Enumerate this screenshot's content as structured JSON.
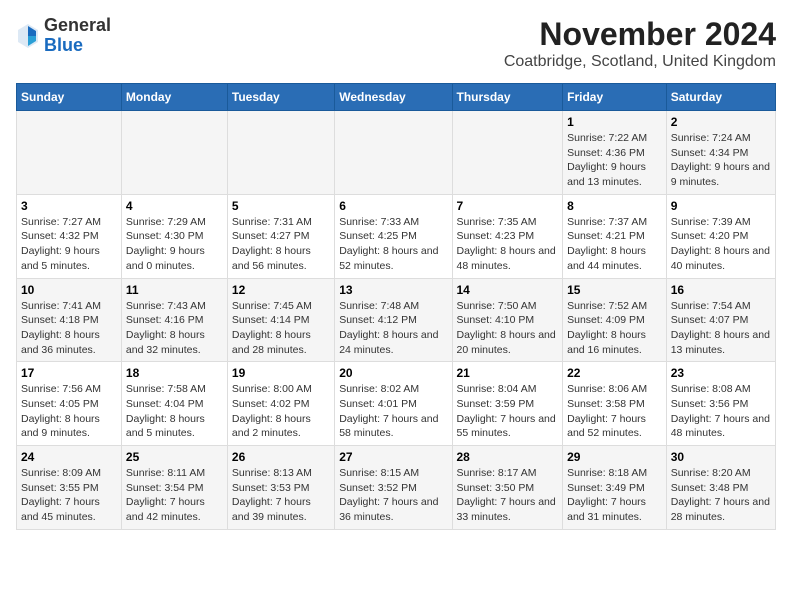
{
  "logo": {
    "general": "General",
    "blue": "Blue"
  },
  "title": "November 2024",
  "subtitle": "Coatbridge, Scotland, United Kingdom",
  "days_of_week": [
    "Sunday",
    "Monday",
    "Tuesday",
    "Wednesday",
    "Thursday",
    "Friday",
    "Saturday"
  ],
  "weeks": [
    [
      {
        "day": "",
        "info": ""
      },
      {
        "day": "",
        "info": ""
      },
      {
        "day": "",
        "info": ""
      },
      {
        "day": "",
        "info": ""
      },
      {
        "day": "",
        "info": ""
      },
      {
        "day": "1",
        "info": "Sunrise: 7:22 AM\nSunset: 4:36 PM\nDaylight: 9 hours and 13 minutes."
      },
      {
        "day": "2",
        "info": "Sunrise: 7:24 AM\nSunset: 4:34 PM\nDaylight: 9 hours and 9 minutes."
      }
    ],
    [
      {
        "day": "3",
        "info": "Sunrise: 7:27 AM\nSunset: 4:32 PM\nDaylight: 9 hours and 5 minutes."
      },
      {
        "day": "4",
        "info": "Sunrise: 7:29 AM\nSunset: 4:30 PM\nDaylight: 9 hours and 0 minutes."
      },
      {
        "day": "5",
        "info": "Sunrise: 7:31 AM\nSunset: 4:27 PM\nDaylight: 8 hours and 56 minutes."
      },
      {
        "day": "6",
        "info": "Sunrise: 7:33 AM\nSunset: 4:25 PM\nDaylight: 8 hours and 52 minutes."
      },
      {
        "day": "7",
        "info": "Sunrise: 7:35 AM\nSunset: 4:23 PM\nDaylight: 8 hours and 48 minutes."
      },
      {
        "day": "8",
        "info": "Sunrise: 7:37 AM\nSunset: 4:21 PM\nDaylight: 8 hours and 44 minutes."
      },
      {
        "day": "9",
        "info": "Sunrise: 7:39 AM\nSunset: 4:20 PM\nDaylight: 8 hours and 40 minutes."
      }
    ],
    [
      {
        "day": "10",
        "info": "Sunrise: 7:41 AM\nSunset: 4:18 PM\nDaylight: 8 hours and 36 minutes."
      },
      {
        "day": "11",
        "info": "Sunrise: 7:43 AM\nSunset: 4:16 PM\nDaylight: 8 hours and 32 minutes."
      },
      {
        "day": "12",
        "info": "Sunrise: 7:45 AM\nSunset: 4:14 PM\nDaylight: 8 hours and 28 minutes."
      },
      {
        "day": "13",
        "info": "Sunrise: 7:48 AM\nSunset: 4:12 PM\nDaylight: 8 hours and 24 minutes."
      },
      {
        "day": "14",
        "info": "Sunrise: 7:50 AM\nSunset: 4:10 PM\nDaylight: 8 hours and 20 minutes."
      },
      {
        "day": "15",
        "info": "Sunrise: 7:52 AM\nSunset: 4:09 PM\nDaylight: 8 hours and 16 minutes."
      },
      {
        "day": "16",
        "info": "Sunrise: 7:54 AM\nSunset: 4:07 PM\nDaylight: 8 hours and 13 minutes."
      }
    ],
    [
      {
        "day": "17",
        "info": "Sunrise: 7:56 AM\nSunset: 4:05 PM\nDaylight: 8 hours and 9 minutes."
      },
      {
        "day": "18",
        "info": "Sunrise: 7:58 AM\nSunset: 4:04 PM\nDaylight: 8 hours and 5 minutes."
      },
      {
        "day": "19",
        "info": "Sunrise: 8:00 AM\nSunset: 4:02 PM\nDaylight: 8 hours and 2 minutes."
      },
      {
        "day": "20",
        "info": "Sunrise: 8:02 AM\nSunset: 4:01 PM\nDaylight: 7 hours and 58 minutes."
      },
      {
        "day": "21",
        "info": "Sunrise: 8:04 AM\nSunset: 3:59 PM\nDaylight: 7 hours and 55 minutes."
      },
      {
        "day": "22",
        "info": "Sunrise: 8:06 AM\nSunset: 3:58 PM\nDaylight: 7 hours and 52 minutes."
      },
      {
        "day": "23",
        "info": "Sunrise: 8:08 AM\nSunset: 3:56 PM\nDaylight: 7 hours and 48 minutes."
      }
    ],
    [
      {
        "day": "24",
        "info": "Sunrise: 8:09 AM\nSunset: 3:55 PM\nDaylight: 7 hours and 45 minutes."
      },
      {
        "day": "25",
        "info": "Sunrise: 8:11 AM\nSunset: 3:54 PM\nDaylight: 7 hours and 42 minutes."
      },
      {
        "day": "26",
        "info": "Sunrise: 8:13 AM\nSunset: 3:53 PM\nDaylight: 7 hours and 39 minutes."
      },
      {
        "day": "27",
        "info": "Sunrise: 8:15 AM\nSunset: 3:52 PM\nDaylight: 7 hours and 36 minutes."
      },
      {
        "day": "28",
        "info": "Sunrise: 8:17 AM\nSunset: 3:50 PM\nDaylight: 7 hours and 33 minutes."
      },
      {
        "day": "29",
        "info": "Sunrise: 8:18 AM\nSunset: 3:49 PM\nDaylight: 7 hours and 31 minutes."
      },
      {
        "day": "30",
        "info": "Sunrise: 8:20 AM\nSunset: 3:48 PM\nDaylight: 7 hours and 28 minutes."
      }
    ]
  ]
}
